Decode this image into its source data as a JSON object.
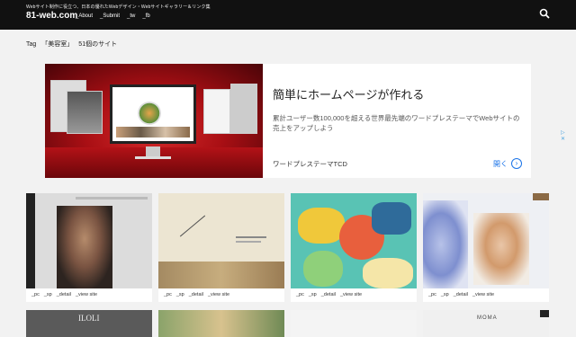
{
  "header": {
    "tagline": "Webサイト制作に役立つ、日本の優れたWebデザイン・Webサイトギャラリー＆リンク集",
    "logo": "81-web.com",
    "nav": [
      "_About",
      "_Submit",
      "_tw",
      "_fb"
    ]
  },
  "tagbar": {
    "label": "Tag",
    "tag": "「美容室」",
    "count": "51個のサイト"
  },
  "ad": {
    "title": "簡単にホームページが作れる",
    "description": "累計ユーザー数100,000を超える世界最先端のワードプレステーマでWebサイトの売上をアップしよう",
    "footer": "ワードプレステーマTCD",
    "open_label": "開く",
    "open_icon": "chevron-right-icon",
    "badge": "▷ ✕"
  },
  "cards": [
    {
      "links": [
        "_pc",
        "_sp",
        "_detail",
        "_view site"
      ],
      "theme": "portrait-dark"
    },
    {
      "links": [
        "_pc",
        "_sp",
        "_detail",
        "_view site"
      ],
      "theme": "beige-minimal"
    },
    {
      "links": [
        "_pc",
        "_sp",
        "_detail",
        "_view site"
      ],
      "theme": "colorful-illustration"
    },
    {
      "links": [
        "_pc",
        "_sp",
        "_detail",
        "_view site"
      ],
      "theme": "portrait-flowers"
    }
  ],
  "row2": [
    {
      "text": "ILOLI"
    },
    {
      "text": ""
    },
    {
      "text": ""
    },
    {
      "text": "MOMA"
    }
  ],
  "colors": {
    "header_bg": "#111111",
    "page_bg": "#f2f2f2",
    "ad_red": "#a90f14",
    "ad_link": "#1a73e8"
  }
}
